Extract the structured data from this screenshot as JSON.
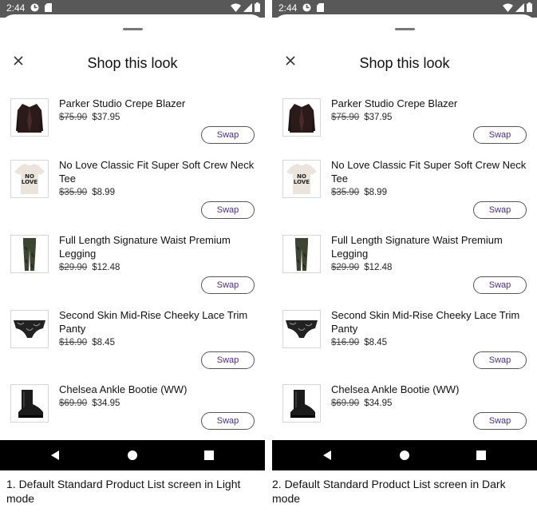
{
  "screens": [
    {
      "status": {
        "time": "2:44"
      },
      "title": "Shop this look",
      "items": [
        {
          "name": "Parker Studio Crepe Blazer",
          "old_price": "$75.90",
          "price": "$37.95",
          "swap": "Swap",
          "icon": "blazer-icon"
        },
        {
          "name": "No Love Classic Fit Super Soft Crew Neck Tee",
          "old_price": "$35.90",
          "price": "$8.99",
          "swap": "Swap",
          "icon": "tee-icon"
        },
        {
          "name": "Full Length Signature Waist Premium Legging",
          "old_price": "$29.90",
          "price": "$12.48",
          "swap": "Swap",
          "icon": "legging-icon"
        },
        {
          "name": "Second Skin Mid-Rise Cheeky Lace Trim Panty",
          "old_price": "$16.90",
          "price": "$8.45",
          "swap": "Swap",
          "icon": "panty-icon"
        },
        {
          "name": "Chelsea Ankle Bootie (WW)",
          "old_price": "$69.90",
          "price": "$34.95",
          "swap": "Swap",
          "icon": "bootie-icon"
        }
      ]
    },
    {
      "status": {
        "time": "2:44"
      },
      "title": "Shop this look",
      "items": [
        {
          "name": "Parker Studio Crepe Blazer",
          "old_price": "$75.90",
          "price": "$37.95",
          "swap": "Swap",
          "icon": "blazer-icon"
        },
        {
          "name": "No Love Classic Fit Super Soft Crew Neck Tee",
          "old_price": "$35.90",
          "price": "$8.99",
          "swap": "Swap",
          "icon": "tee-icon"
        },
        {
          "name": "Full Length Signature Waist Premium Legging",
          "old_price": "$29.90",
          "price": "$12.48",
          "swap": "Swap",
          "icon": "legging-icon"
        },
        {
          "name": "Second Skin Mid-Rise Cheeky Lace Trim Panty",
          "old_price": "$16.90",
          "price": "$8.45",
          "swap": "Swap",
          "icon": "panty-icon"
        },
        {
          "name": "Chelsea Ankle Bootie (WW)",
          "old_price": "$69.90",
          "price": "$34.95",
          "swap": "Swap",
          "icon": "bootie-icon"
        }
      ]
    }
  ],
  "captions": [
    "1. Default Standard Product List screen in Light mode",
    "2. Default Standard Product List screen in Dark mode"
  ],
  "colors": {
    "swap_text": "#4a2a8a",
    "status_bar": "#585858",
    "nav_bar": "#000000"
  }
}
